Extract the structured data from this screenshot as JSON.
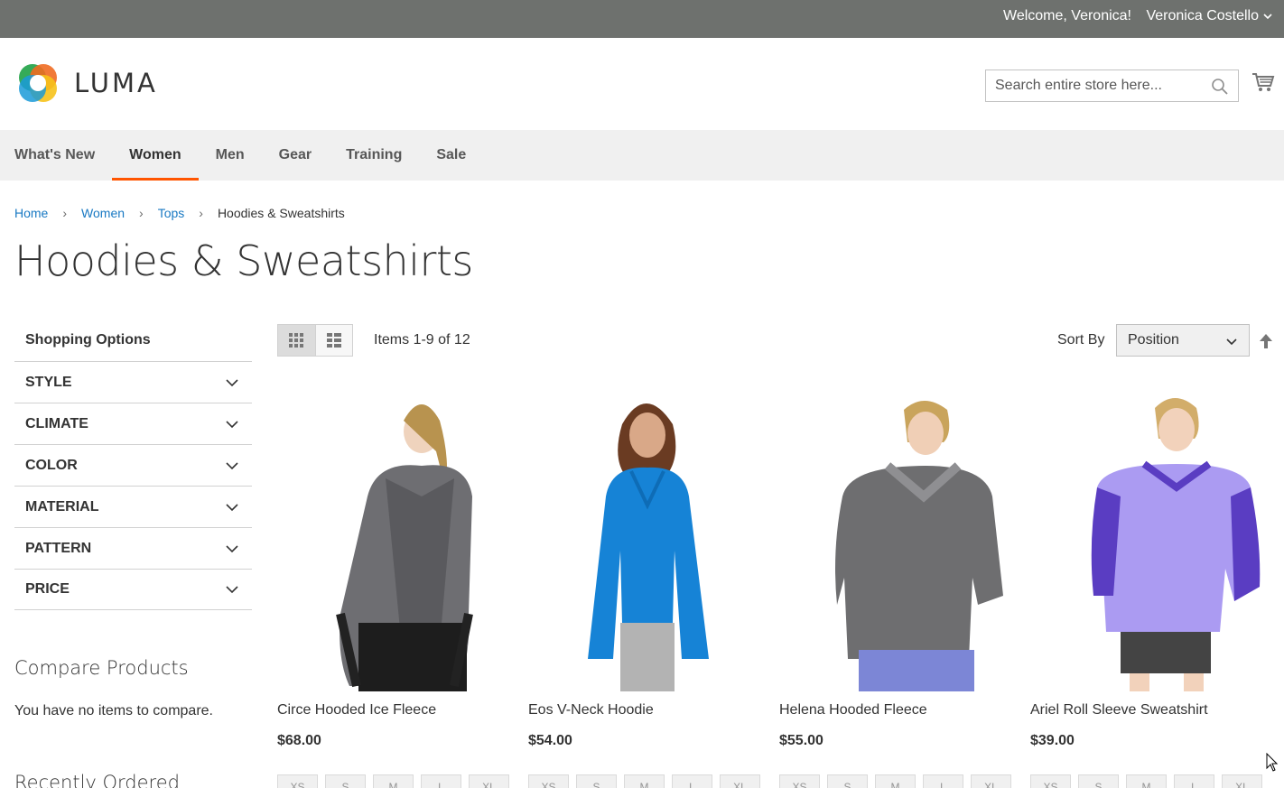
{
  "topbar": {
    "welcome": "Welcome, Veronica!",
    "customer_name": "Veronica Costello"
  },
  "header": {
    "logo_text": "LUMA",
    "search_placeholder": "Search entire store here..."
  },
  "nav": {
    "items": [
      "What's New",
      "Women",
      "Men",
      "Gear",
      "Training",
      "Sale"
    ],
    "active": "Women"
  },
  "breadcrumb": {
    "home": "Home",
    "women": "Women",
    "tops": "Tops",
    "current": "Hoodies & Sweatshirts"
  },
  "page_title": "Hoodies & Sweatshirts",
  "sidebar": {
    "title": "Shopping Options",
    "filters": [
      "STYLE",
      "CLIMATE",
      "COLOR",
      "MATERIAL",
      "PATTERN",
      "PRICE"
    ],
    "compare_title": "Compare Products",
    "compare_empty": "You have no items to compare.",
    "recent_title": "Recently Ordered"
  },
  "toolbar": {
    "amount": "Items 1-9 of 12",
    "sort_label": "Sort By",
    "sort_value": "Position"
  },
  "products": [
    {
      "name": "Circe Hooded Ice Fleece",
      "price": "$68.00"
    },
    {
      "name": "Eos V-Neck Hoodie",
      "price": "$54.00"
    },
    {
      "name": "Helena Hooded Fleece",
      "price": "$55.00"
    },
    {
      "name": "Ariel Roll Sleeve Sweatshirt",
      "price": "$39.00"
    }
  ],
  "sizes": [
    "XS",
    "S",
    "M",
    "L",
    "XL"
  ],
  "colors": {
    "topbar": "#6e716e",
    "nav_bg": "#f0f0f0",
    "nav_active": "#ff5501",
    "link": "#1979c3"
  }
}
